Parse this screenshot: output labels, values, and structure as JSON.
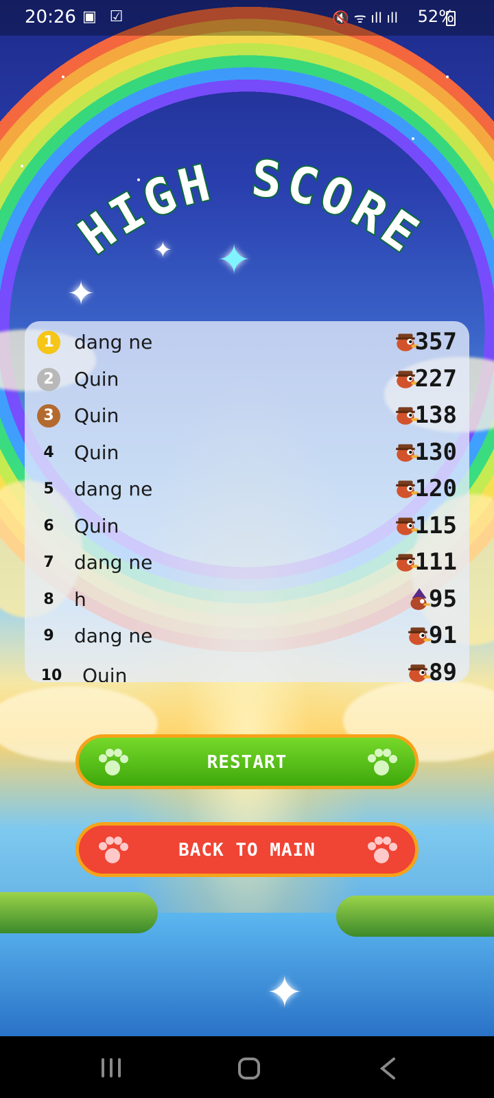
{
  "status": {
    "time": "20:26",
    "battery": "52%",
    "left_icons": "▣ ☑",
    "right_icons": "🔇 ᯤ ıll ıll"
  },
  "title": "HIGH SCORE",
  "leaderboard": [
    {
      "rank": "1",
      "name": "dang ne",
      "score": "357",
      "medal": "#f5c518",
      "avatar": "bird-red-hat"
    },
    {
      "rank": "2",
      "name": "Quin",
      "score": "227",
      "medal": "#b8b8b8",
      "avatar": "bird-red-hat"
    },
    {
      "rank": "3",
      "name": "Quin",
      "score": "138",
      "medal": "#b36a2e",
      "avatar": "bird-red-hat"
    },
    {
      "rank": "4",
      "name": "Quin",
      "score": "130",
      "avatar": "bird-red-hat"
    },
    {
      "rank": "5",
      "name": "dang ne",
      "score": "120",
      "avatar": "bird-red-hat"
    },
    {
      "rank": "6",
      "name": "Quin",
      "score": "115",
      "avatar": "bird-red-hat"
    },
    {
      "rank": "7",
      "name": "dang ne",
      "score": "111",
      "avatar": "bird-red-hat"
    },
    {
      "rank": "8",
      "name": "h",
      "score": "95",
      "avatar": "bird-wizard"
    },
    {
      "rank": "9",
      "name": "dang ne",
      "score": "91",
      "avatar": "bird-red-hat"
    },
    {
      "rank": "10",
      "name": "Quin",
      "score": "89",
      "avatar": "bird-red-hat"
    }
  ],
  "buttons": {
    "restart": {
      "label": "RESTART",
      "color": "#4fbf12"
    },
    "back": {
      "label": "BACK TO MAIN",
      "color": "#f04434"
    }
  },
  "colors": {
    "button_border": "#f6a21a",
    "title_fill": "#ffffff",
    "title_stroke": "#0c6b3a"
  }
}
